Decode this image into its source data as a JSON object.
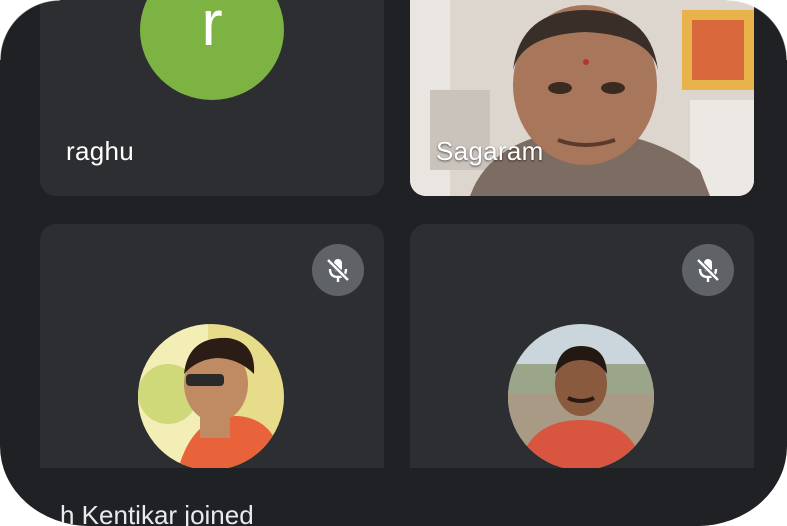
{
  "participants": [
    {
      "name": "raghu",
      "avatar_letter": "r",
      "avatar_color": "#7cb342"
    },
    {
      "name": "Sagaram",
      "video": "camera-feed"
    },
    {
      "name": "",
      "muted": true,
      "avatar": "profile-photo"
    },
    {
      "name": "",
      "muted": true,
      "avatar": "profile-photo"
    }
  ],
  "icons": {
    "mic_off": "mic-off-icon"
  },
  "colors": {
    "background": "#202124",
    "tile": "#2d2e31",
    "mic_button": "#5f6368",
    "avatar_green": "#7cb342"
  },
  "toast": {
    "text": "h Kentikar joined"
  }
}
